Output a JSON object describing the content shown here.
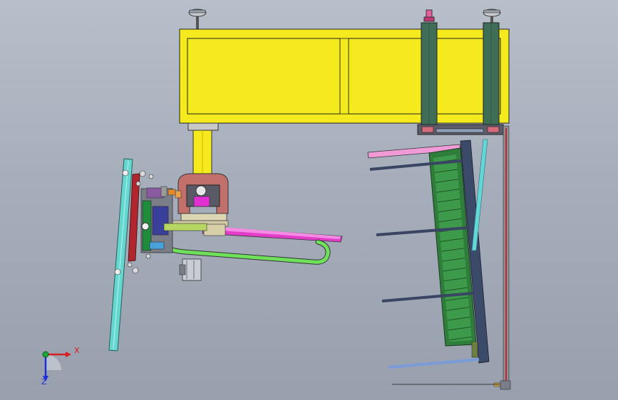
{
  "viewport": {
    "background_top": "#b7bfca",
    "background_bottom": "#98a0ad"
  },
  "triad": {
    "x_label": "X",
    "z_label": "Z",
    "x_color": "#d81e1e",
    "y_color": "#1ea83a",
    "z_color": "#1e2fd8"
  },
  "model": {
    "frame_color": "#f5ea1e",
    "column_color": "#3f6e57",
    "arm_color": "#e23dc8",
    "hose_color": "#6fe05a",
    "panel_color": "#2f7d3a",
    "glass_color": "#66d7d0"
  }
}
